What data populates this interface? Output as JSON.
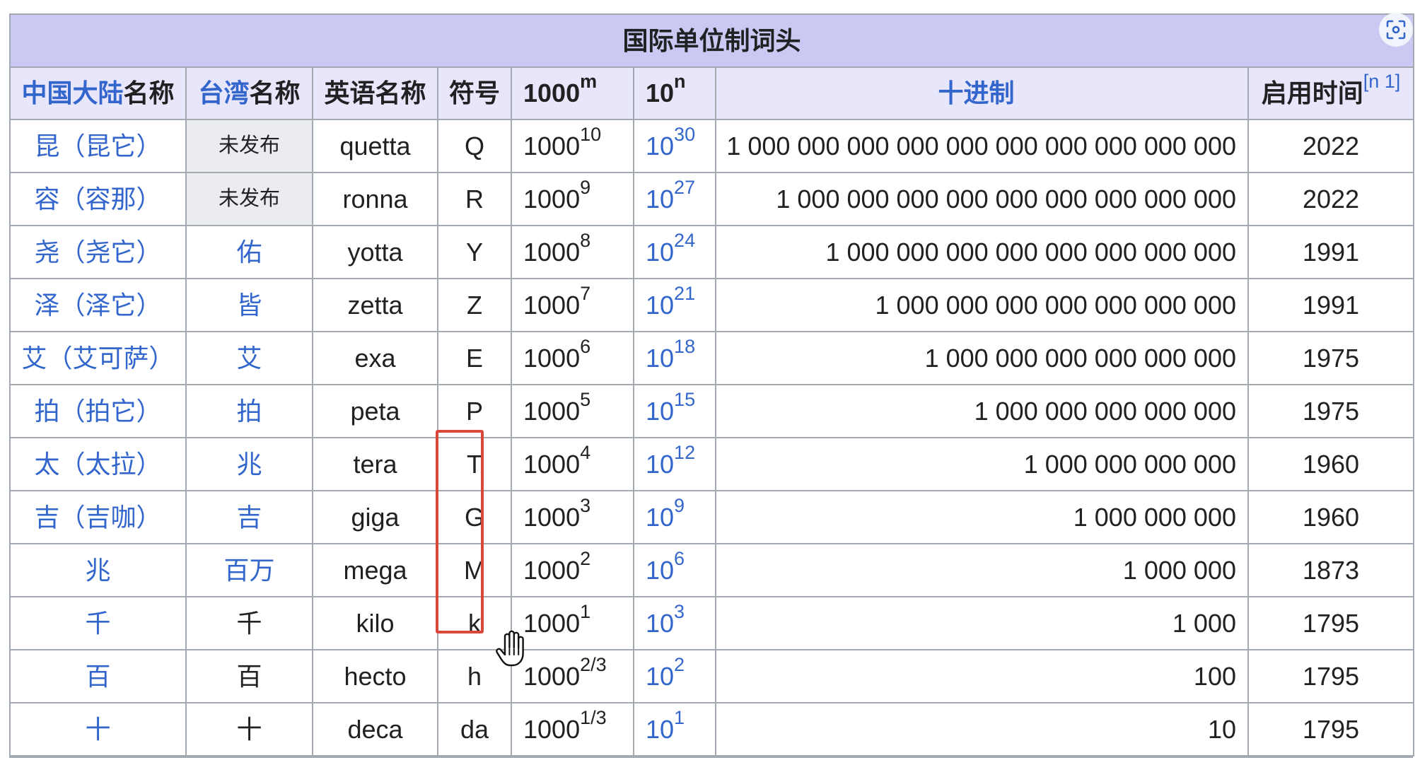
{
  "table": {
    "caption": "国际单位制词头",
    "headers": {
      "cn_link": "中国大陆",
      "cn_rest": "名称",
      "tw_link": "台湾",
      "tw_rest": "名称",
      "en": "英语名称",
      "symbol": "符号",
      "m_base": "1000",
      "m_exp": "m",
      "n_base": "10",
      "n_exp": "n",
      "decimal": "十进制",
      "year": "启用时间",
      "year_cite": "[n 1]"
    },
    "rows": [
      {
        "cn": "昆（昆它）",
        "tw": "未发布",
        "en": "quetta",
        "sym": "Q",
        "m_base": "1000",
        "m_exp": "10",
        "n_base": "10",
        "n_exp": "30",
        "dec": "1 000 000 000 000 000 000 000 000 000 000",
        "year": "2022"
      },
      {
        "cn": "容（容那）",
        "tw": "未发布",
        "en": "ronna",
        "sym": "R",
        "m_base": "1000",
        "m_exp": "9",
        "n_base": "10",
        "n_exp": "27",
        "dec": "1 000 000 000 000 000 000 000 000 000",
        "year": "2022"
      },
      {
        "cn": "尧（尧它）",
        "tw": "佑",
        "en": "yotta",
        "sym": "Y",
        "m_base": "1000",
        "m_exp": "8",
        "n_base": "10",
        "n_exp": "24",
        "dec": "1 000 000 000 000 000 000 000 000",
        "year": "1991"
      },
      {
        "cn": "泽（泽它）",
        "tw": "皆",
        "en": "zetta",
        "sym": "Z",
        "m_base": "1000",
        "m_exp": "7",
        "n_base": "10",
        "n_exp": "21",
        "dec": "1 000 000 000 000 000 000 000",
        "year": "1991"
      },
      {
        "cn": "艾（艾可萨）",
        "tw": "艾",
        "en": "exa",
        "sym": "E",
        "m_base": "1000",
        "m_exp": "6",
        "n_base": "10",
        "n_exp": "18",
        "dec": "1 000 000 000 000 000 000",
        "year": "1975"
      },
      {
        "cn": "拍（拍它）",
        "tw": "拍",
        "en": "peta",
        "sym": "P",
        "m_base": "1000",
        "m_exp": "5",
        "n_base": "10",
        "n_exp": "15",
        "dec": "1 000 000 000 000 000",
        "year": "1975"
      },
      {
        "cn": "太（太拉）",
        "tw": "兆",
        "en": "tera",
        "sym": "T",
        "m_base": "1000",
        "m_exp": "4",
        "n_base": "10",
        "n_exp": "12",
        "dec": "1 000 000 000 000",
        "year": "1960"
      },
      {
        "cn": "吉（吉咖）",
        "tw": "吉",
        "en": "giga",
        "sym": "G",
        "m_base": "1000",
        "m_exp": "3",
        "n_base": "10",
        "n_exp": "9",
        "dec": "1 000 000 000",
        "year": "1960"
      },
      {
        "cn": "兆",
        "tw": "百万",
        "en": "mega",
        "sym": "M",
        "m_base": "1000",
        "m_exp": "2",
        "n_base": "10",
        "n_exp": "6",
        "dec": "1 000 000",
        "year": "1873"
      },
      {
        "cn": "千",
        "tw": "千",
        "en": "kilo",
        "sym": "k",
        "m_base": "1000",
        "m_exp": "1",
        "n_base": "10",
        "n_exp": "3",
        "dec": "1 000",
        "year": "1795"
      },
      {
        "cn": "百",
        "tw": "百",
        "en": "hecto",
        "sym": "h",
        "m_base": "1000",
        "m_exp": "2/3",
        "n_base": "10",
        "n_exp": "2",
        "dec": "100",
        "year": "1795"
      },
      {
        "cn": "十",
        "tw": "十",
        "en": "deca",
        "sym": "da",
        "m_base": "1000",
        "m_exp": "1/3",
        "n_base": "10",
        "n_exp": "1",
        "dec": "10",
        "year": "1795"
      }
    ]
  },
  "colors": {
    "link": "#3366cc",
    "caption_bg": "#cbc9f4",
    "header_bg": "#e8e6fb",
    "highlight": "#d9483b"
  },
  "icons": {
    "focus": "focus-scan-icon",
    "cursor": "hand-pointer-cursor"
  }
}
